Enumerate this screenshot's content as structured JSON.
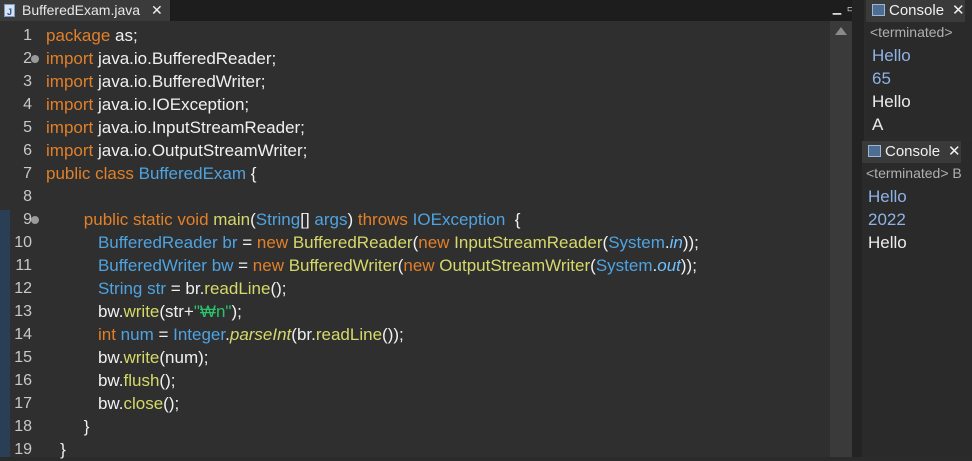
{
  "editor": {
    "tab": {
      "filename": "BufferedExam.java",
      "close": "✕"
    },
    "window_controls": {
      "minimize": "▁",
      "maximize": "▭"
    }
  },
  "code_lines": [
    {
      "n": "1",
      "html": "<span class='kw'>package</span> as;"
    },
    {
      "n": "2",
      "fold": true,
      "html": "<span class='kw'>import</span> java.io.BufferedReader;"
    },
    {
      "n": "3",
      "html": "<span class='kw'>import</span> java.io.BufferedWriter;"
    },
    {
      "n": "4",
      "html": "<span class='kw'>import</span> java.io.IOException;"
    },
    {
      "n": "5",
      "html": "<span class='kw'>import</span> java.io.InputStreamReader;"
    },
    {
      "n": "6",
      "html": "<span class='kw'>import</span> java.io.OutputStreamWriter;"
    },
    {
      "n": "7",
      "html": "<span class='kw'>public class</span> <span class='cls'>BufferedExam</span> {"
    },
    {
      "n": "8",
      "html": ""
    },
    {
      "n": "9",
      "fold": true,
      "html": "        <span class='kw'>public static void</span> <span class='mth'>main</span>(<span class='cls'>String</span>[] <span class='cls'>args</span>) <span class='kw'>throws</span> <span class='cls'>IOException</span>  {"
    },
    {
      "n": "10",
      "html": "           <span class='cls'>BufferedReader</span> <span class='cls'>br</span> = <span class='kw'>new</span> <span class='mth'>BufferedReader</span>(<span class='kw'>new</span> <span class='mth'>InputStreamReader</span>(<span class='cls'>System</span>.<span class='itf'>in</span>));"
    },
    {
      "n": "11",
      "html": "           <span class='cls'>BufferedWriter</span> <span class='cls'>bw</span> = <span class='kw'>new</span> <span class='mth'>BufferedWriter</span>(<span class='kw'>new</span> <span class='mth'>OutputStreamWriter</span>(<span class='cls'>System</span>.<span class='itf'>out</span>));"
    },
    {
      "n": "12",
      "html": "           <span class='cls'>String</span> <span class='cls'>str</span> = br.<span class='mth'>readLine</span>();"
    },
    {
      "n": "13",
      "html": "           bw.<span class='mth'>write</span>(str+<span class='str'>\"₩n\"</span>);"
    },
    {
      "n": "14",
      "html": "           <span class='kw'>int</span> <span class='cls'>num</span> = <span class='cls'>Integer</span>.<span class='itm'>parseInt</span>(br.<span class='mth'>readLine</span>());"
    },
    {
      "n": "15",
      "html": "           bw.<span class='mth'>write</span>(num);"
    },
    {
      "n": "16",
      "html": "           bw.<span class='mth'>flush</span>();"
    },
    {
      "n": "17",
      "html": "           bw.<span class='mth'>close</span>();"
    },
    {
      "n": "18",
      "html": "        }"
    },
    {
      "n": "19",
      "html": "   }"
    }
  ],
  "console1": {
    "title": "Console",
    "close": "✕",
    "status": "<terminated>",
    "lines": [
      {
        "text": "Hello",
        "kind": "in"
      },
      {
        "text": "65",
        "kind": "in"
      },
      {
        "text": "Hello",
        "kind": "out"
      },
      {
        "text": "A",
        "kind": "out"
      }
    ]
  },
  "console2": {
    "title": "Console",
    "close": "✕",
    "status": "<terminated> B",
    "lines": [
      {
        "text": "Hello",
        "kind": "in"
      },
      {
        "text": "2022",
        "kind": "in"
      },
      {
        "text": "Hello",
        "kind": "out"
      }
    ]
  }
}
